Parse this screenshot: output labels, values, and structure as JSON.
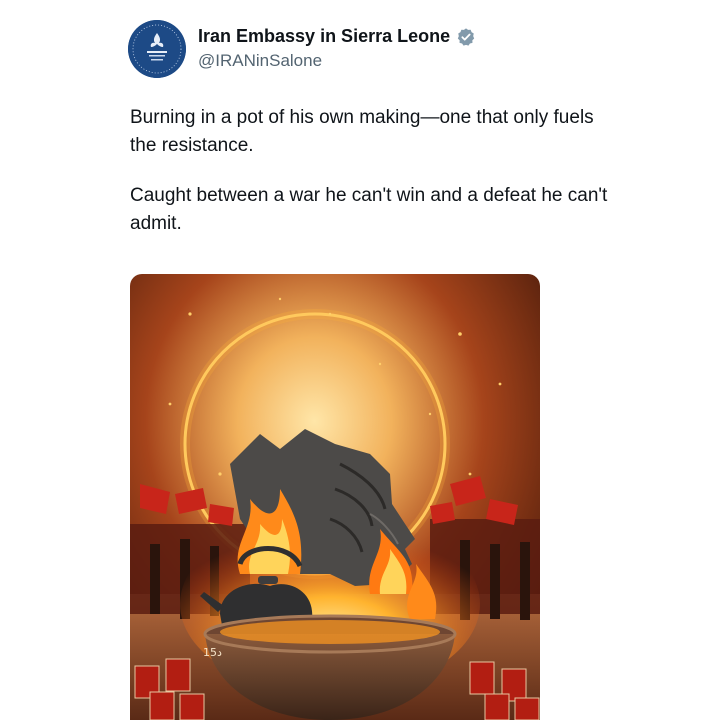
{
  "tweet": {
    "author": {
      "display_name": "Iran Embassy in Sierra Leone",
      "handle": "@IRANinSalone",
      "verified": true,
      "avatar_icon": "embassy-emblem-icon"
    },
    "paragraphs": [
      "Burning in a pot of his own making—one that only fuels the resistance.",
      "Caught between a war he can't win and a defeat he can't admit."
    ],
    "media": {
      "kind": "image",
      "corner_mark": "د15"
    }
  },
  "colors": {
    "verified_badge": "#829aab",
    "avatar_bg": "#1d4a86",
    "handle_text": "#536471",
    "fire": "#ff9a1f",
    "sky": "#3a1408"
  }
}
